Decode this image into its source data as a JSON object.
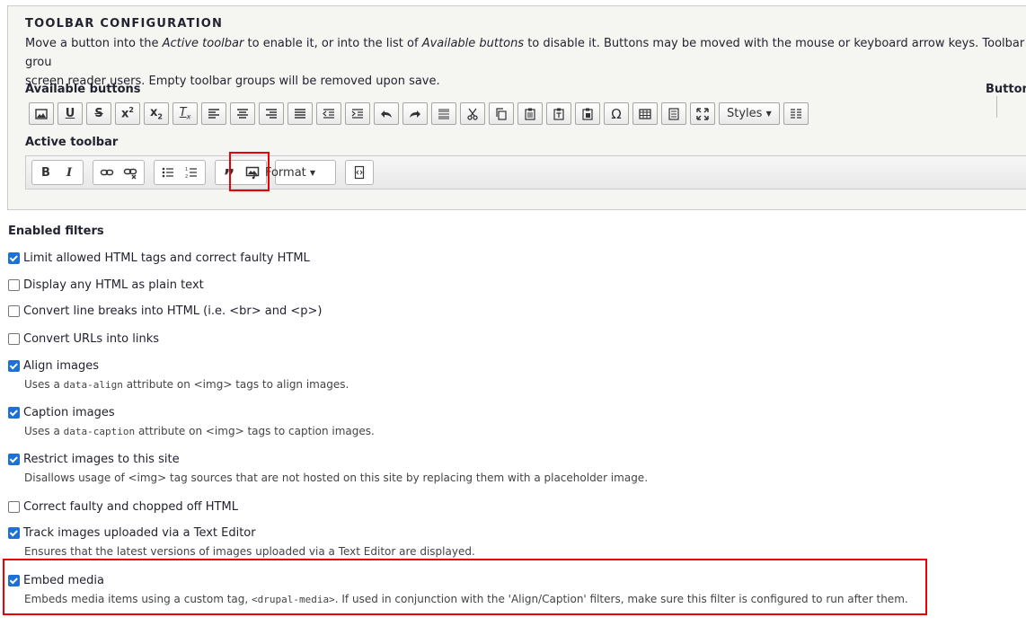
{
  "toolbar_config": {
    "title": "TOOLBAR CONFIGURATION",
    "description": "Move a button into the Active toolbar to enable it, or into the list of Available buttons to disable it. Buttons may be moved with the mouse or keyboard arrow keys. Toolbar grou… screen reader users. Empty toolbar groups will be removed upon save.",
    "available_label": "Available buttons",
    "active_label": "Active toolbar",
    "right_label": "Button",
    "available_buttons": [
      "image-icon",
      "underline-icon",
      "strikethrough-icon",
      "superscript-icon",
      "subscript-icon",
      "remove-format-icon",
      "align-left-icon",
      "align-center-icon",
      "align-right-icon",
      "justify-icon",
      "outdent-icon",
      "indent-icon",
      "undo-icon",
      "redo-icon",
      "horizontal-line-icon",
      "cut-icon",
      "copy-icon",
      "paste-icon",
      "paste-text-icon",
      "paste-word-icon",
      "special-char-icon",
      "table-icon",
      "show-blocks-icon",
      "maximize-icon"
    ],
    "styles_label": "Styles",
    "format_label": "Format",
    "bold_label": "B",
    "italic_label": "I",
    "underline_label": "U",
    "strike_label": "S",
    "omega_label": "Ω"
  },
  "filters": {
    "title": "Enabled filters",
    "items": [
      {
        "label": "Limit allowed HTML tags and correct faulty HTML",
        "checked": true
      },
      {
        "label": "Display any HTML as plain text",
        "checked": false
      },
      {
        "label": "Convert line breaks into HTML (i.e. <br> and <p>)",
        "checked": false
      },
      {
        "label": "Convert URLs into links",
        "checked": false
      },
      {
        "label": "Align images",
        "checked": true,
        "desc_pre": "Uses a ",
        "desc_code": "data-align",
        "desc_post": " attribute on <img> tags to align images."
      },
      {
        "label": "Caption images",
        "checked": true,
        "desc_pre": "Uses a ",
        "desc_code": "data-caption",
        "desc_post": " attribute on <img> tags to caption images."
      },
      {
        "label": "Restrict images to this site",
        "checked": true,
        "desc": "Disallows usage of <img> tag sources that are not hosted on this site by replacing them with a placeholder image."
      },
      {
        "label": "Correct faulty and chopped off HTML",
        "checked": false
      },
      {
        "label": "Track images uploaded via a Text Editor",
        "checked": true,
        "desc": "Ensures that the latest versions of images uploaded via a Text Editor are displayed."
      },
      {
        "label": "Embed media",
        "checked": true,
        "desc_pre": "Embeds media items using a custom tag, ",
        "desc_code": "<drupal-media>",
        "desc_post": ". If used in conjunction with the 'Align/Caption' filters, make sure this filter is configured to run after them."
      }
    ]
  },
  "colors": {
    "highlight": "#e00000",
    "checkbox": "#1d71d6",
    "panel": "#f5f5f2"
  }
}
